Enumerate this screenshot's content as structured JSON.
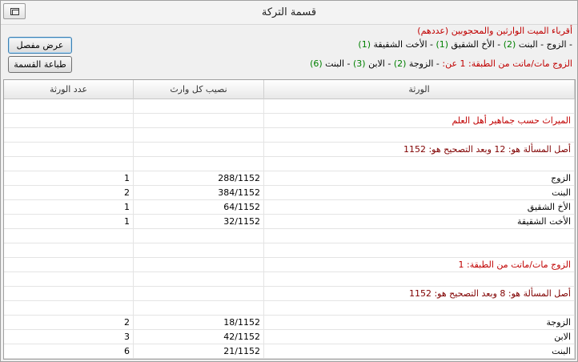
{
  "window": {
    "title": "قسمة التركة"
  },
  "header": {
    "heirs_title": "أقرباء الميت الوارثين والمحجوبين (عددهم)",
    "line1": [
      {
        "text": "- الزوج - البنت ",
        "color": "black"
      },
      {
        "text": "(2)",
        "color": "green"
      },
      {
        "text": " - الأخ الشقيق ",
        "color": "black"
      },
      {
        "text": "(1)",
        "color": "green"
      },
      {
        "text": " - الأخت الشقيقة ",
        "color": "black"
      },
      {
        "text": "(1)",
        "color": "green"
      }
    ],
    "line2": [
      {
        "text": "الزوج مات/ماتت من الطبقة: 1 عن: ",
        "color": "red"
      },
      {
        "text": "- الزوجة ",
        "color": "black"
      },
      {
        "text": "(2)",
        "color": "green"
      },
      {
        "text": " - الابن ",
        "color": "black"
      },
      {
        "text": "(3)",
        "color": "green"
      },
      {
        "text": " - البنت ",
        "color": "black"
      },
      {
        "text": "(6)",
        "color": "green"
      }
    ]
  },
  "buttons": {
    "details": "عرض مفصل",
    "print": "طباعة القسمة"
  },
  "table": {
    "columns": {
      "heirs": "الورثة",
      "share": "نصيب كل وارث",
      "count": "عدد الورثة"
    },
    "rows": [
      {
        "heir": "",
        "share": "",
        "count": "",
        "style": "plain"
      },
      {
        "heir": "الميراث حسب جماهير أهل العلم",
        "share": "",
        "count": "",
        "style": "red"
      },
      {
        "heir": "",
        "share": "",
        "count": "",
        "style": "plain"
      },
      {
        "heir": "أصل المسألة هو: 12 وبعد التصحيح هو: 1152",
        "share": "",
        "count": "",
        "style": "maroon"
      },
      {
        "heir": "",
        "share": "",
        "count": "",
        "style": "plain"
      },
      {
        "heir": "الزوج",
        "share": "288/1152",
        "count": "1",
        "style": "plain"
      },
      {
        "heir": "البنت",
        "share": "384/1152",
        "count": "2",
        "style": "plain"
      },
      {
        "heir": "الأخ الشقيق",
        "share": "64/1152",
        "count": "1",
        "style": "plain"
      },
      {
        "heir": "الأخت الشقيقة",
        "share": "32/1152",
        "count": "1",
        "style": "plain"
      },
      {
        "heir": "",
        "share": "",
        "count": "",
        "style": "plain"
      },
      {
        "heir": "",
        "share": "",
        "count": "",
        "style": "plain"
      },
      {
        "heir": "الزوج مات/ماتت من الطبقة: 1",
        "share": "",
        "count": "",
        "style": "red"
      },
      {
        "heir": "",
        "share": "",
        "count": "",
        "style": "plain"
      },
      {
        "heir": "أصل المسألة هو: 8 وبعد التصحيح هو: 1152",
        "share": "",
        "count": "",
        "style": "maroon"
      },
      {
        "heir": "",
        "share": "",
        "count": "",
        "style": "plain"
      },
      {
        "heir": "الزوجة",
        "share": "18/1152",
        "count": "2",
        "style": "plain"
      },
      {
        "heir": "الابن",
        "share": "42/1152",
        "count": "3",
        "style": "plain"
      },
      {
        "heir": "البنت",
        "share": "21/1152",
        "count": "6",
        "style": "plain"
      },
      {
        "heir": "",
        "share": "",
        "count": "",
        "style": "plain"
      }
    ]
  },
  "colors": {
    "red": "#c00000",
    "green": "#008000",
    "maroon": "#800000"
  }
}
